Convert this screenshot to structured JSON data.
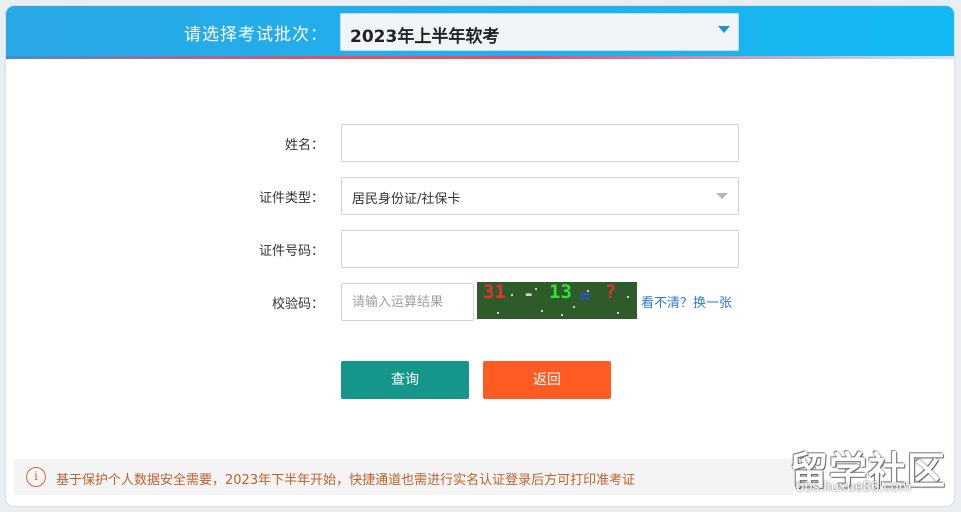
{
  "header": {
    "batch_label": "请选择考试批次：",
    "batch_selected": "2023年上半年软考",
    "colors": {
      "bar": "#1fb0ee",
      "accent_line": "#e84a6e"
    }
  },
  "form": {
    "name": {
      "label": "姓名：",
      "value": ""
    },
    "id_type": {
      "label": "证件类型：",
      "selected": "居民身份证/社保卡"
    },
    "id_number": {
      "label": "证件号码：",
      "value": ""
    },
    "captcha": {
      "label": "校验码：",
      "placeholder": "请输入运算结果",
      "image_tokens": [
        "31",
        "-",
        "13",
        "=",
        "?"
      ],
      "refresh_link": "看不清？换一张"
    }
  },
  "buttons": {
    "query": "查询",
    "back": "返回",
    "colors": {
      "query": "#14968a",
      "back": "#ff5b23"
    }
  },
  "notice": {
    "icon": "info-icon",
    "text": "基于保护个人数据安全需要，2023年下半年开始，快捷通道也需进行实名认证登录后方可打印准考证"
  },
  "watermark": {
    "logo": "留学社区",
    "url": "bbs.liuxue86.com"
  }
}
